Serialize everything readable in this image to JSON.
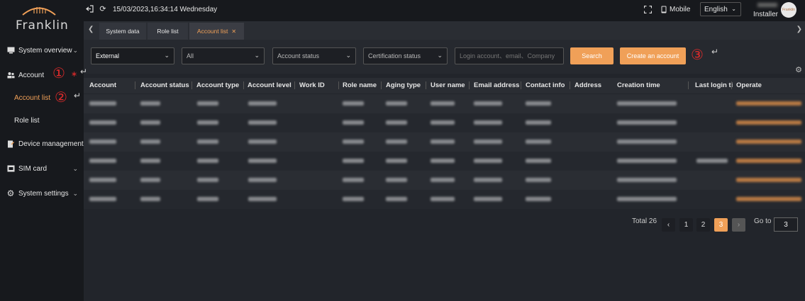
{
  "brand": {
    "logo_text": "Franklin"
  },
  "sidebar": {
    "items": [
      {
        "label": "System overview"
      },
      {
        "label": "Account"
      },
      {
        "label": "Device management"
      },
      {
        "label": "SIM card"
      },
      {
        "label": "System settings"
      }
    ],
    "sub_items": [
      {
        "label": "Account list"
      },
      {
        "label": "Role list"
      }
    ]
  },
  "topbar": {
    "datetime": "15/03/2023,16:34:14 Wednesday",
    "mobile_label": "Mobile",
    "language": "English",
    "role": "Installer",
    "avatar_text": "Franklin"
  },
  "tabs": [
    {
      "label": "System data"
    },
    {
      "label": "Role list"
    },
    {
      "label": "Account list"
    }
  ],
  "filters": {
    "user_type": "External",
    "scope": "All",
    "account_status_placeholder": "Account status",
    "certification_placeholder": "Certification status",
    "search_placeholder": "Login account、email、Company",
    "search_label": "Search",
    "create_label": "Create an account"
  },
  "annotations": {
    "one": "①",
    "two": "②",
    "three": "③"
  },
  "table": {
    "headers": [
      "Account",
      "Account status",
      "Account type",
      "Account level",
      "Work ID",
      "Role name",
      "Aging type",
      "User name",
      "Email address",
      "Contact info",
      "Address",
      "Creation time",
      "Last login ti",
      "Operate"
    ]
  },
  "pagination": {
    "total": "Total 26",
    "pages": [
      "1",
      "2",
      "3"
    ],
    "current": "3",
    "goto_label": "Go to",
    "goto_value": "3"
  },
  "colors": {
    "accent": "#f0a058",
    "annotation": "#e02b2b",
    "sidebar_bg": "#17191d"
  }
}
